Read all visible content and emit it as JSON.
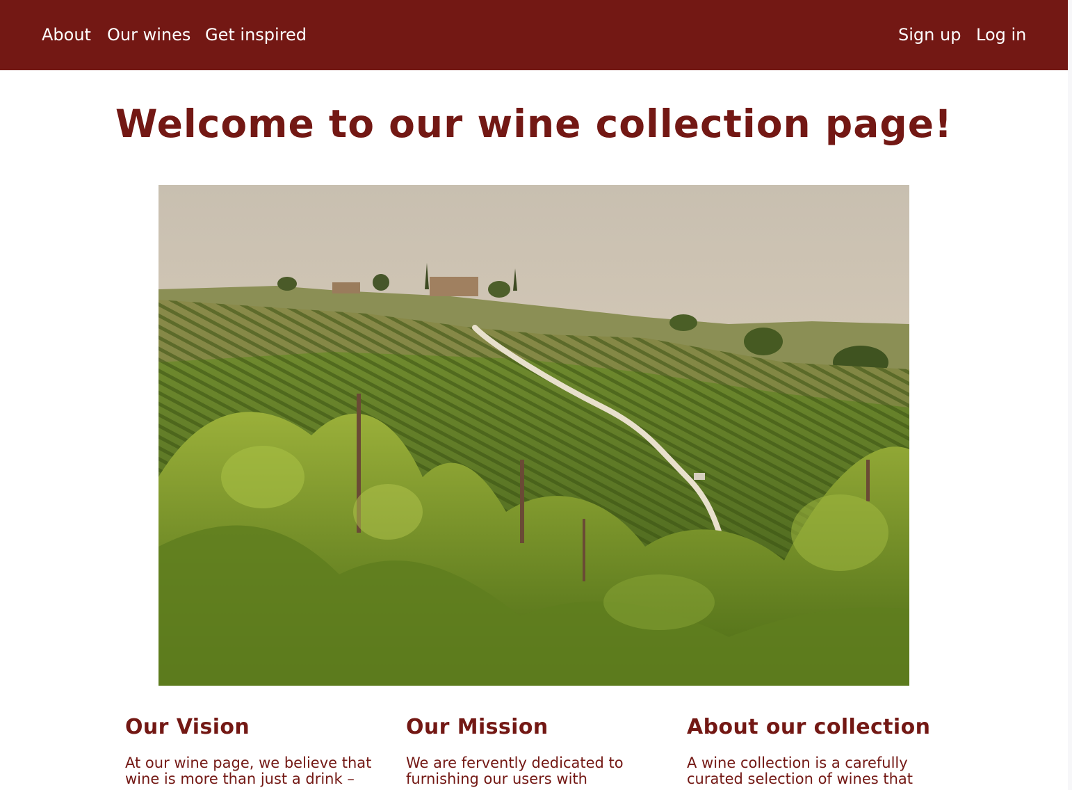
{
  "nav": {
    "left_links": [
      "About",
      "Our wines",
      "Get inspired"
    ],
    "right_links": [
      "Sign up",
      "Log in"
    ]
  },
  "main": {
    "title": "Welcome to our wine collection page!",
    "hero_image": "vineyard-landscape"
  },
  "sections": [
    {
      "heading": "Our Vision",
      "body": "At our wine page, we believe that wine is more than just a drink –"
    },
    {
      "heading": "Our Mission",
      "body": "We are fervently dedicated to furnishing our users with"
    },
    {
      "heading": "About our collection",
      "body": "A wine collection is a carefully curated selection of wines that"
    }
  ],
  "colors": {
    "brand": "#731814",
    "nav_text": "#ffffff",
    "background": "#ffffff"
  }
}
